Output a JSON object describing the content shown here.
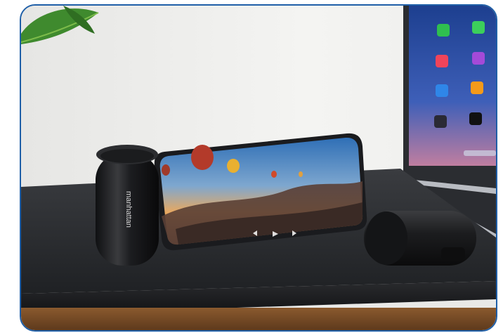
{
  "photo": {
    "brand_text": "manhattan",
    "frame_color": "#1f5fa8",
    "subjects": [
      "phone-stand-power-bank-icon",
      "smartphone-icon",
      "laptop-icon",
      "compact-power-bank-icon",
      "plant-leaf-icon"
    ]
  }
}
